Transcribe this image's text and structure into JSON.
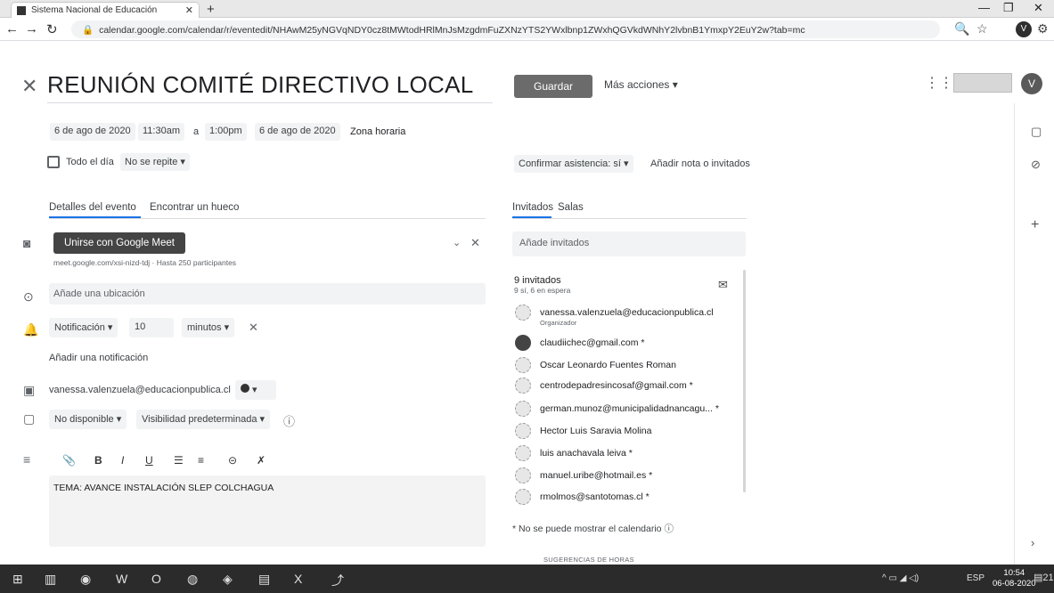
{
  "browser": {
    "tab_title": "Sistema Nacional de Educación",
    "url": "calendar.google.com/calendar/r/eventedit/NHAwM25yNGVqNDY0cz8tMWtodHRlMnJsMzgdmFuZXNzYTS2YWxlbnp1ZWxhQGVkdWNhY2lvbnB1YmxpY2EuY2w?tab=mc"
  },
  "header": {
    "title": "REUNIÓN COMITÉ DIRECTIVO LOCAL",
    "save_label": "Guardar",
    "more_actions_label": "Más acciones"
  },
  "datetime": {
    "start_date": "6 de ago de 2020",
    "start_time": "11:30am",
    "to_label": "a",
    "end_time": "1:00pm",
    "end_date": "6 de ago de 2020",
    "timezone_label": "Zona horaria",
    "all_day_label": "Todo el día",
    "repeat_label": "No se repite"
  },
  "rsvp": {
    "label": "Confirmar asistencia: sí",
    "add_note_label": "Añadir nota o invitados"
  },
  "left_tabs": {
    "details": "Detalles del evento",
    "find_time": "Encontrar un hueco"
  },
  "right_tabs": {
    "guests": "Invitados",
    "rooms": "Salas"
  },
  "meet": {
    "button_label": "Unirse con Google Meet",
    "info": "meet.google.com/xsi-nizd-tdj · Hasta 250 participantes"
  },
  "location": {
    "placeholder": "Añade una ubicación"
  },
  "notification": {
    "type": "Notificación",
    "value": "10",
    "unit": "minutos",
    "add_label": "Añadir una notificación"
  },
  "calendar_owner": "vanessa.valenzuela@educacionpublica.cl",
  "availability": {
    "status": "No disponible",
    "visibility": "Visibilidad predeterminada"
  },
  "description": {
    "text": "TEMA: AVANCE INSTALACIÓN SLEP COLCHAGUA"
  },
  "guests": {
    "input_placeholder": "Añade invitados",
    "count_label": "9 invitados",
    "status_label": "9 sí, 6 en espera",
    "list": [
      {
        "name": "vanessa.valenzuela@educacionpublica.cl",
        "role": "Organizador"
      },
      {
        "name": "claudiichec@gmail.com *",
        "role": ""
      },
      {
        "name": "Oscar Leonardo Fuentes Roman",
        "role": ""
      },
      {
        "name": "centrodepadresincosaf@gmail.com *",
        "role": ""
      },
      {
        "name": "german.munoz@municipalidadnancagu... *",
        "role": ""
      },
      {
        "name": "Hector Luis Saravia Molina",
        "role": ""
      },
      {
        "name": "luis anachavala leiva *",
        "role": ""
      },
      {
        "name": "manuel.uribe@hotmail.es *",
        "role": ""
      },
      {
        "name": "rmolmos@santotomas.cl *",
        "role": ""
      }
    ],
    "calendar_note": "* No se puede mostrar el calendario",
    "suggestions_label": "SUGERENCIAS DE HORAS"
  },
  "taskbar": {
    "lang": "ESP",
    "time": "10:54",
    "date": "06-08-2020",
    "notif_count": "21"
  }
}
